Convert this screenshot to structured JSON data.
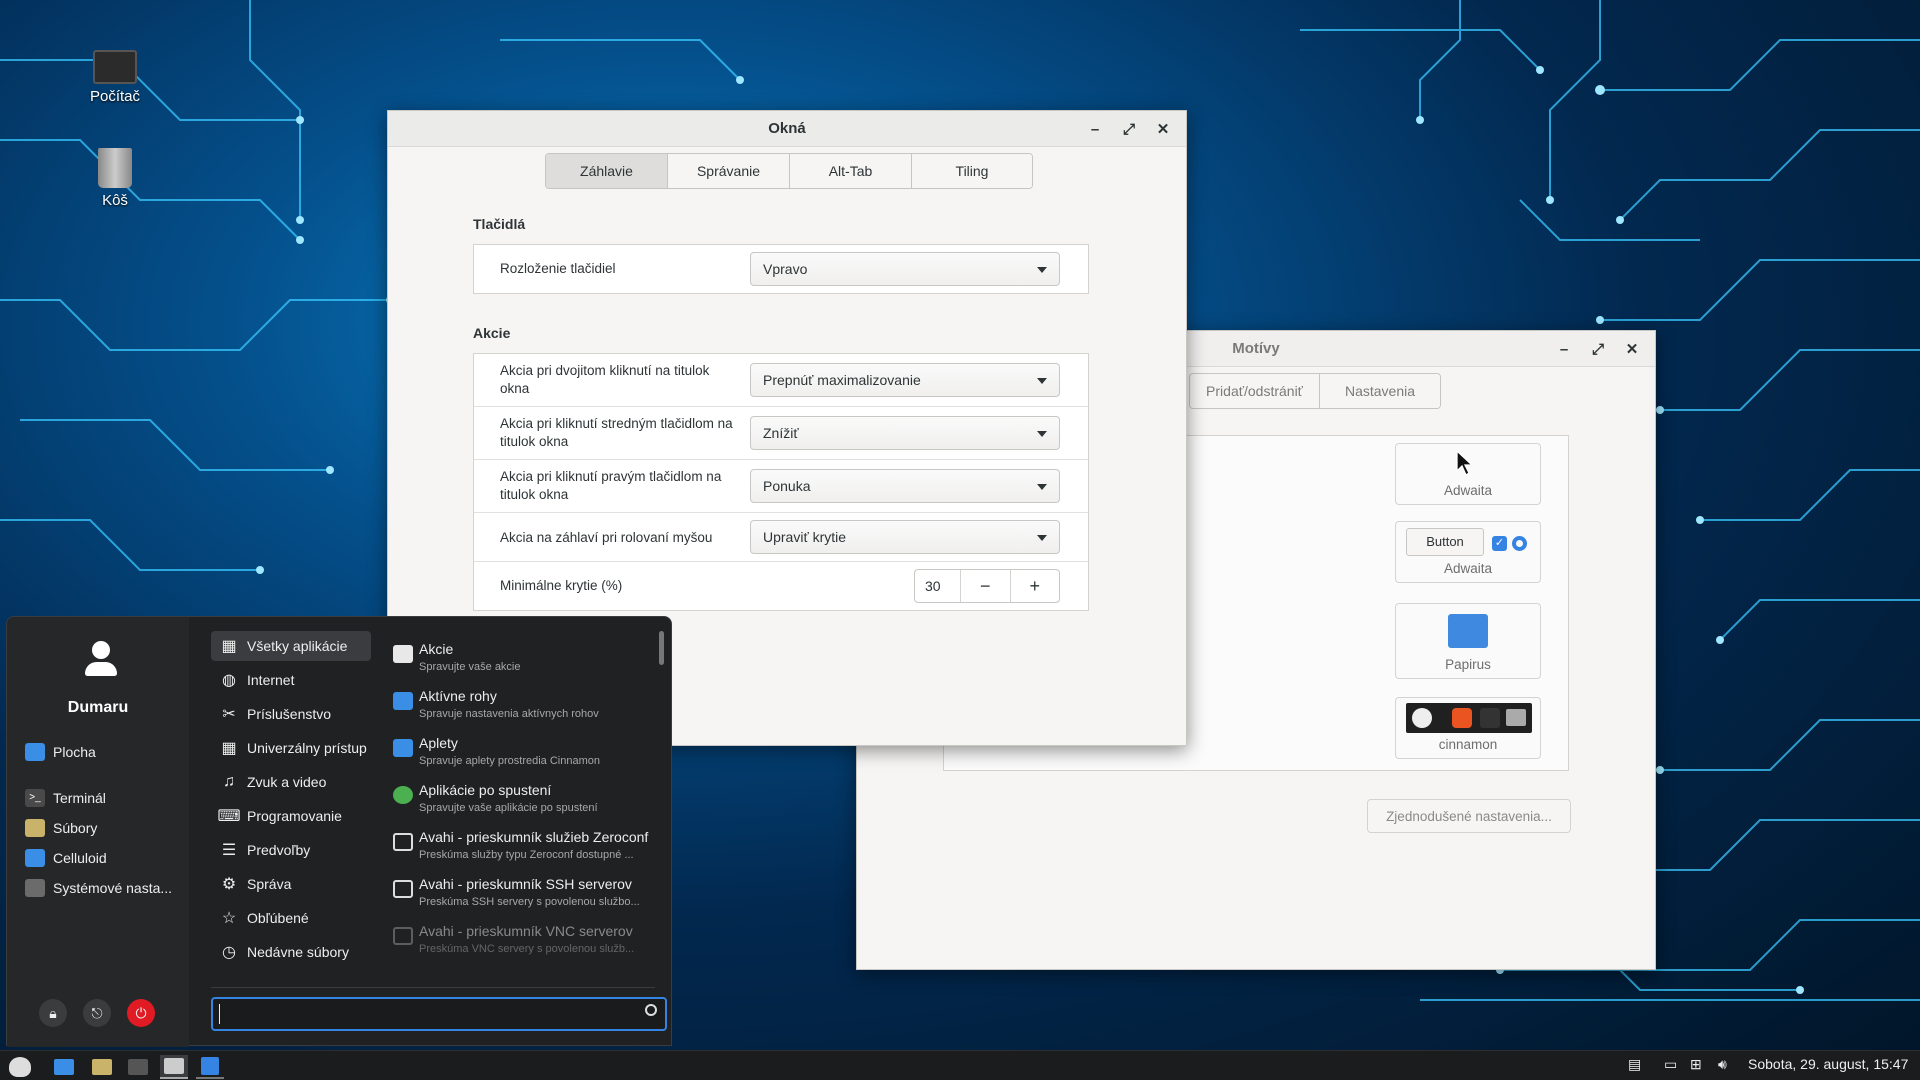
{
  "desktop": {
    "icons": [
      {
        "label": "Počítač",
        "icon": "computer-icon"
      },
      {
        "label": "Kôš",
        "icon": "trash-icon"
      }
    ]
  },
  "okna_window": {
    "title": "Okná",
    "tabs": [
      "Záhlavie",
      "Správanie",
      "Alt-Tab",
      "Tiling"
    ],
    "active_tab": "Záhlavie",
    "sections": {
      "buttons_header": "Tlačidlá",
      "layout_label": "Rozloženie tlačidiel",
      "layout_value": "Vpravo",
      "actions_header": "Akcie",
      "rows": [
        {
          "label": "Akcia pri dvojitom kliknutí na titulok okna",
          "value": "Prepnúť maximalizovanie"
        },
        {
          "label": "Akcia pri kliknutí stredným tlačidlom na titulok okna",
          "value": "Znížiť"
        },
        {
          "label": "Akcia pri kliknutí pravým tlačidlom na titulok okna",
          "value": "Ponuka"
        },
        {
          "label": "Akcia na záhlaví pri rolovaní myšou",
          "value": "Upraviť krytie"
        }
      ],
      "min_opacity_label": "Minimálne krytie (%)",
      "min_opacity_value": "30",
      "minus": "−",
      "plus": "+"
    }
  },
  "themes_window": {
    "title": "Motívy",
    "tabs": [
      "Pridať/odstrániť",
      "Nastavenia"
    ],
    "themes": [
      {
        "caption": "Adwaita"
      },
      {
        "caption": "Adwaita",
        "preview_button": "Button"
      },
      {
        "caption": "Papirus"
      },
      {
        "caption": "cinnamon"
      }
    ],
    "simple_settings": "Zjednodušené nastavenia..."
  },
  "menu": {
    "user": "Dumaru",
    "places": [
      {
        "label": "Plocha",
        "color": "#3a8ee6"
      },
      {
        "label": "Terminál",
        "color": "#4a4a4a"
      },
      {
        "label": "Súbory",
        "color": "#c9b36a"
      },
      {
        "label": "Celluloid",
        "color": "#3a8ee6"
      },
      {
        "label": "Systémové nasta...",
        "color": "#6b6b6b"
      }
    ],
    "categories": [
      {
        "label": "Všetky aplikácie",
        "glyph": "▦"
      },
      {
        "label": "Internet",
        "glyph": "◍"
      },
      {
        "label": "Príslušenstvo",
        "glyph": "✂"
      },
      {
        "label": "Univerzálny prístup",
        "glyph": "▦"
      },
      {
        "label": "Zvuk a video",
        "glyph": "♫"
      },
      {
        "label": "Programovanie",
        "glyph": "⌨"
      },
      {
        "label": "Predvoľby",
        "glyph": "☰"
      },
      {
        "label": "Správa",
        "glyph": "⚙"
      },
      {
        "label": "Obľúbené",
        "glyph": "☆"
      },
      {
        "label": "Nedávne súbory",
        "glyph": "◷"
      }
    ],
    "apps": [
      {
        "name": "Akcie",
        "desc": "Spravujte vaše akcie",
        "color": "#e8e8e8"
      },
      {
        "name": "Aktívne rohy",
        "desc": "Spravuje nastavenia aktívnych rohov",
        "color": "#3a8ee6"
      },
      {
        "name": "Aplety",
        "desc": "Spravuje aplety prostredia Cinnamon",
        "color": "#3a8ee6"
      },
      {
        "name": "Aplikácie po spustení",
        "desc": "Spravujte vaše aplikácie po spustení",
        "color": "#4caf50"
      },
      {
        "name": "Avahi - prieskumník služieb Zeroconf",
        "desc": "Preskúma služby typu Zeroconf dostupné ...",
        "color": "#dddddd"
      },
      {
        "name": "Avahi - prieskumník SSH serverov",
        "desc": "Preskúma SSH servery s povolenou službo...",
        "color": "#dddddd"
      },
      {
        "name": "Avahi - prieskumník VNC serverov",
        "desc": "Preskúma VNC servery s povolenou služb...",
        "color": "#999999"
      }
    ],
    "search_placeholder": ""
  },
  "taskbar": {
    "clock": "Sobota, 29. august, 15:47"
  }
}
